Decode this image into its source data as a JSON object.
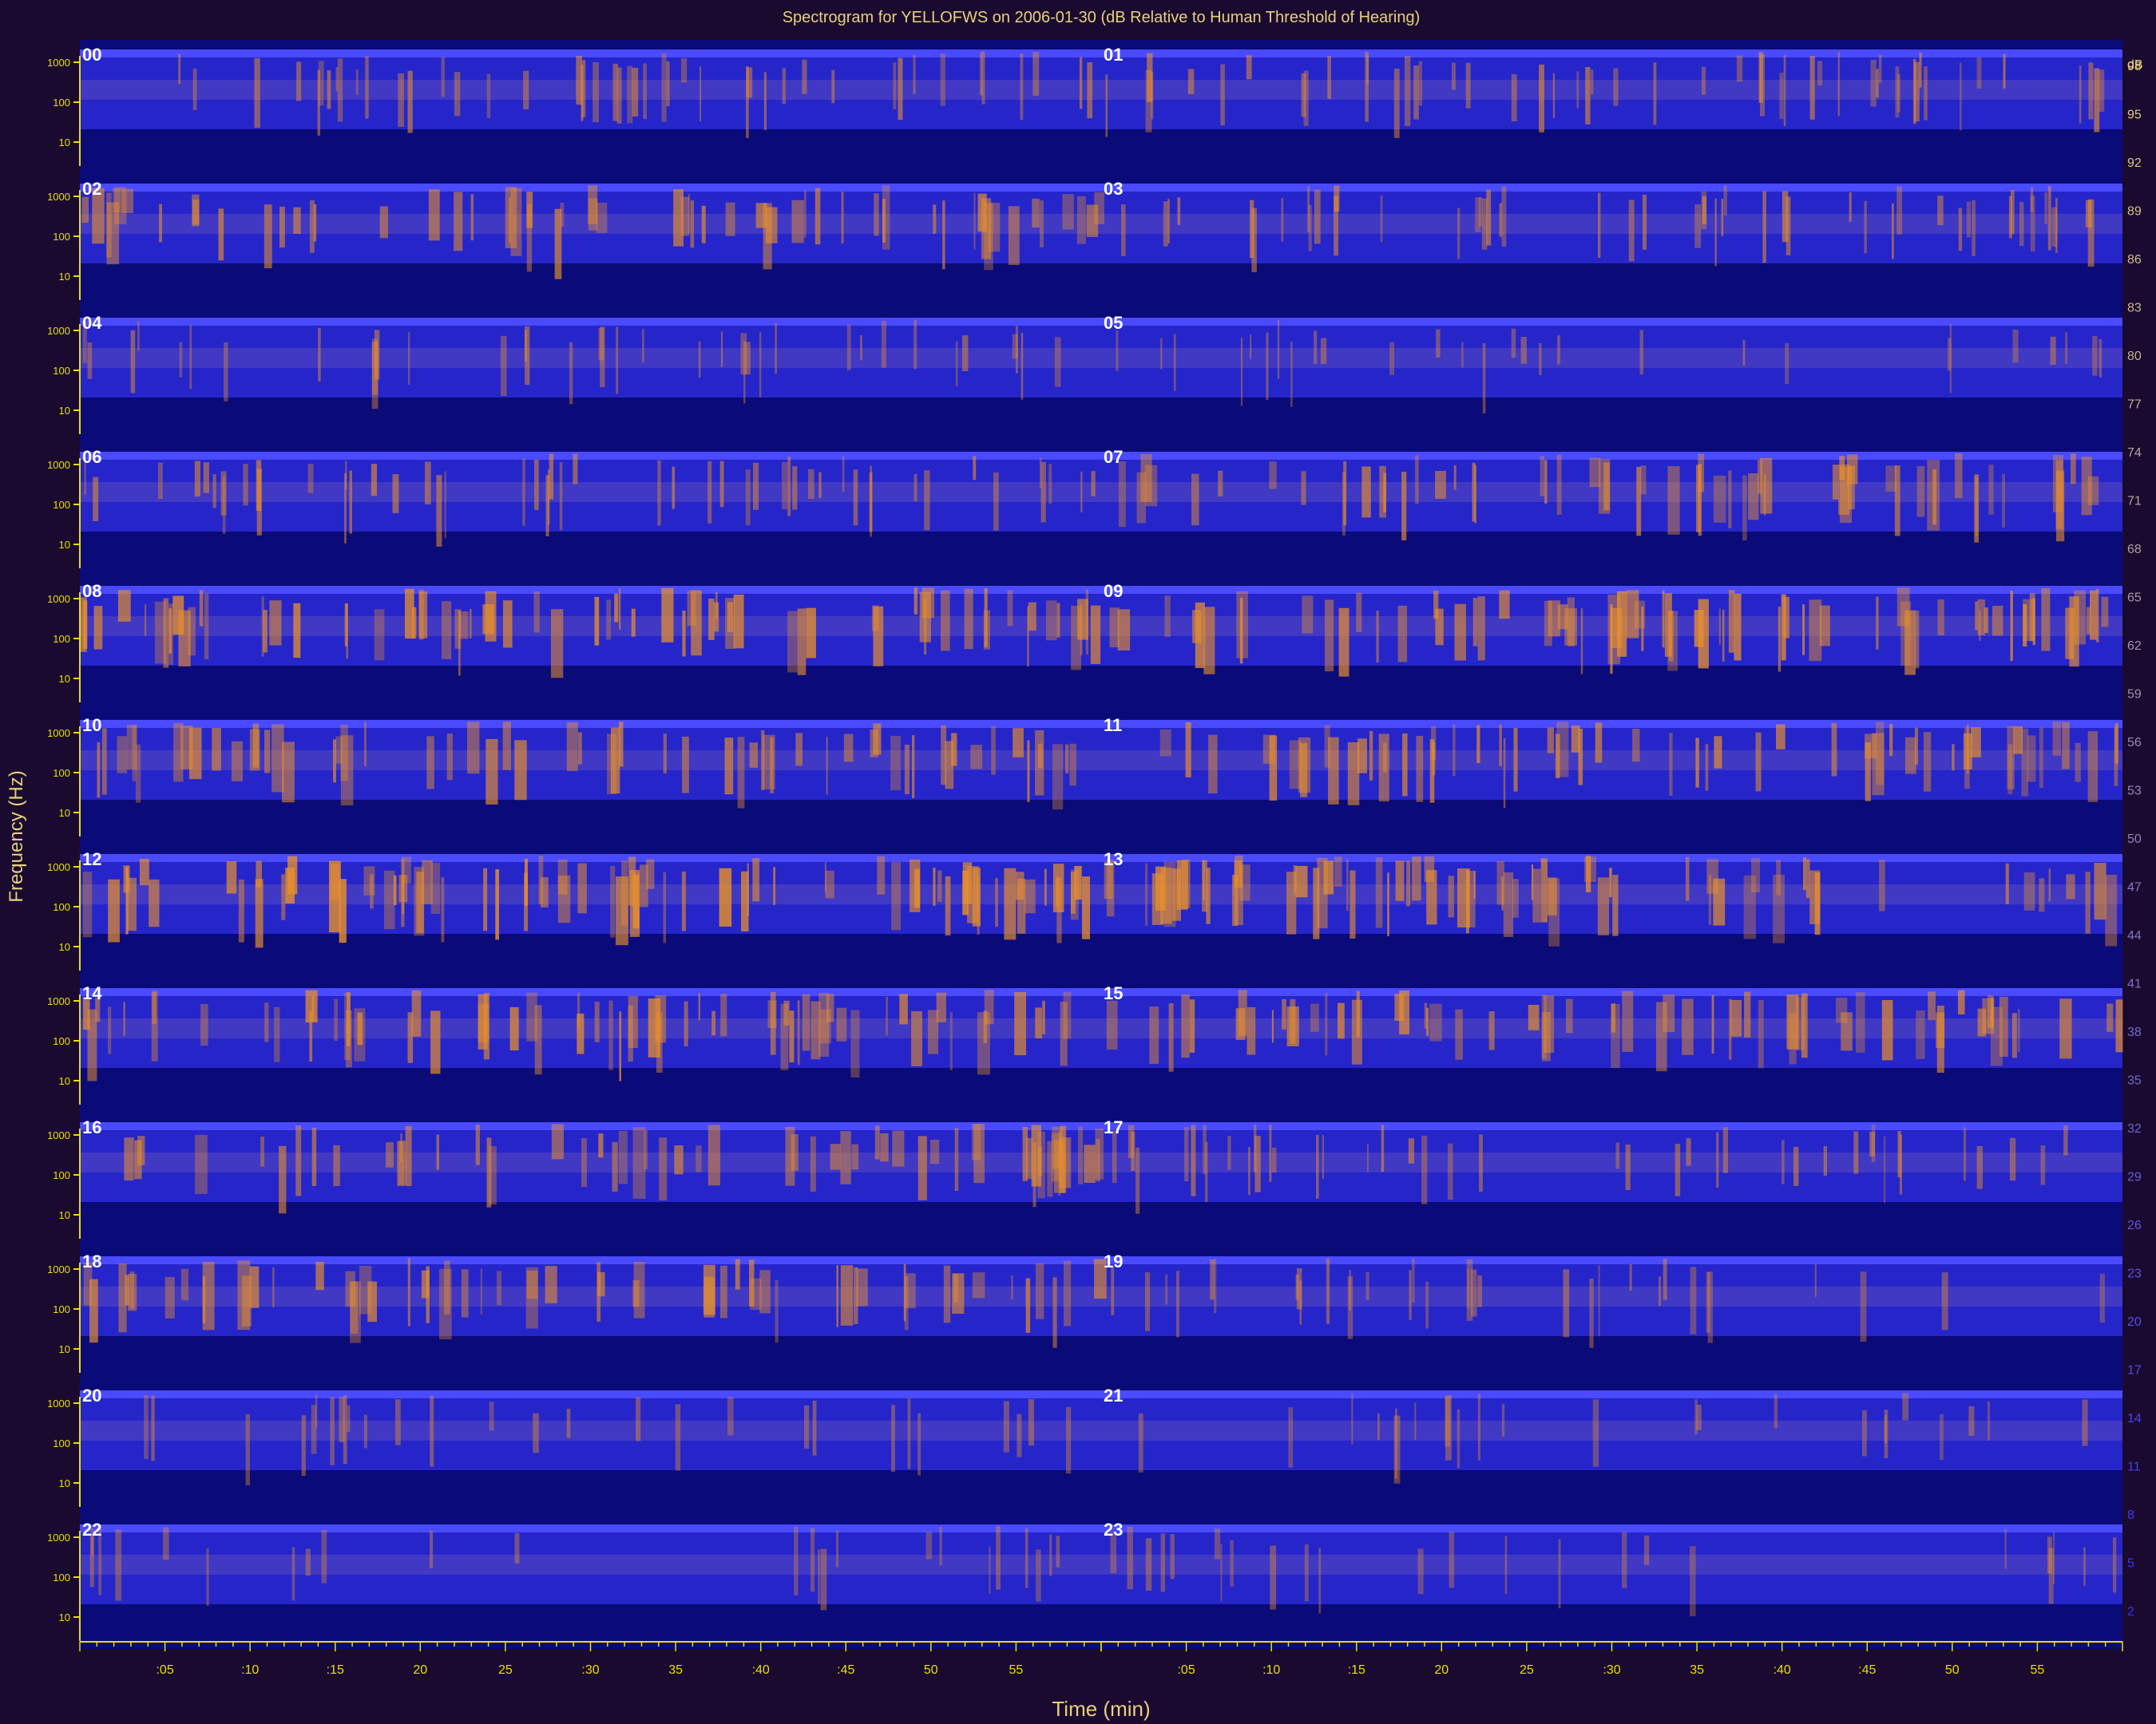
{
  "chart_data": {
    "type": "heatmap",
    "title": "Spectrogram for YELLOFWS on 2006-01-30 (dB Relative to Human Threshold of Hearing)",
    "xlabel": "Time (min)",
    "ylabel": "Frequency (Hz)",
    "x_ticks": [
      ":05",
      ":10",
      ":15",
      "20",
      "25",
      ":30",
      "35",
      ":40",
      ":45",
      "50",
      "55"
    ],
    "y_ticks": [
      "1000",
      "100",
      "10"
    ],
    "hour_labels": [
      "00",
      "01",
      "02",
      "03",
      "04",
      "05",
      "06",
      "07",
      "08",
      "09",
      "10",
      "11",
      "12",
      "13",
      "14",
      "15",
      "16",
      "17",
      "18",
      "19",
      "20",
      "21",
      "22",
      "23"
    ],
    "hour_activity": [
      0.4,
      0.45,
      0.55,
      0.45,
      0.3,
      0.2,
      0.45,
      0.55,
      0.7,
      0.7,
      0.55,
      0.6,
      0.8,
      0.7,
      0.65,
      0.6,
      0.55,
      0.35,
      0.55,
      0.25,
      0.2,
      0.15,
      0.15,
      0.15
    ],
    "colorbar": {
      "unit": "dB",
      "ticks": [
        "98",
        "95",
        "92",
        "89",
        "86",
        "83",
        "80",
        "77",
        "74",
        "71",
        "68",
        "65",
        "62",
        "59",
        "56",
        "53",
        "50",
        "47",
        "44",
        "41",
        "38",
        "35",
        "32",
        "29",
        "26",
        "23",
        "20",
        "17",
        "14",
        "11",
        "8",
        "5",
        "2"
      ]
    },
    "colors": {
      "background": "#1a0a30",
      "panel": "#0a0a78",
      "band": "#2a2ad8",
      "band_bright": "#4a4aff",
      "hot": "#e8902a",
      "axis": "#e8e000",
      "label": "#e8d07a"
    }
  }
}
